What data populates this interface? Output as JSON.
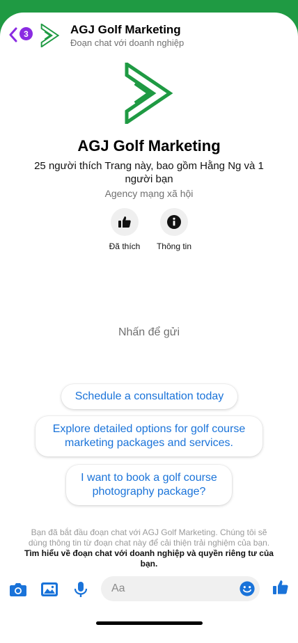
{
  "header": {
    "back_count": "3",
    "title": "AGJ Golf Marketing",
    "subtitle": "Đoạn chat với doanh nghiệp"
  },
  "profile": {
    "name": "AGJ Golf Marketing",
    "likes_line": "25 người thích Trang này, bao gồm Hằng Ng và 1 người bạn",
    "category": "Agency mạng xã hội"
  },
  "actions": {
    "liked_label": "Đã thích",
    "info_label": "Thông tin"
  },
  "chat": {
    "tap_to_send": "Nhấn để gửi",
    "suggestions": [
      "Schedule a consultation today",
      "Explore detailed options for golf course marketing packages and services.",
      "I want to book a golf course photography package?"
    ],
    "disclaimer_text": "Bạn đã bắt đầu đoạn chat với AGJ Golf Marketing. Chúng tôi sẽ dùng thông tin từ đoạn chat này để cải thiện trải nghiệm của bạn.",
    "disclaimer_link": "Tìm hiểu về đoạn chat với doanh nghiệp và quyền riêng tư của bạn."
  },
  "composer": {
    "placeholder": "Aa"
  },
  "colors": {
    "brand_green": "#1f9a43",
    "messenger_blue": "#1a73d9",
    "badge_purple": "#8a2be2"
  },
  "icons": [
    "chevron-left-icon",
    "logo-icon",
    "thumbs-up-icon",
    "info-icon",
    "camera-icon",
    "image-icon",
    "microphone-icon",
    "emoji-icon",
    "like-icon"
  ]
}
